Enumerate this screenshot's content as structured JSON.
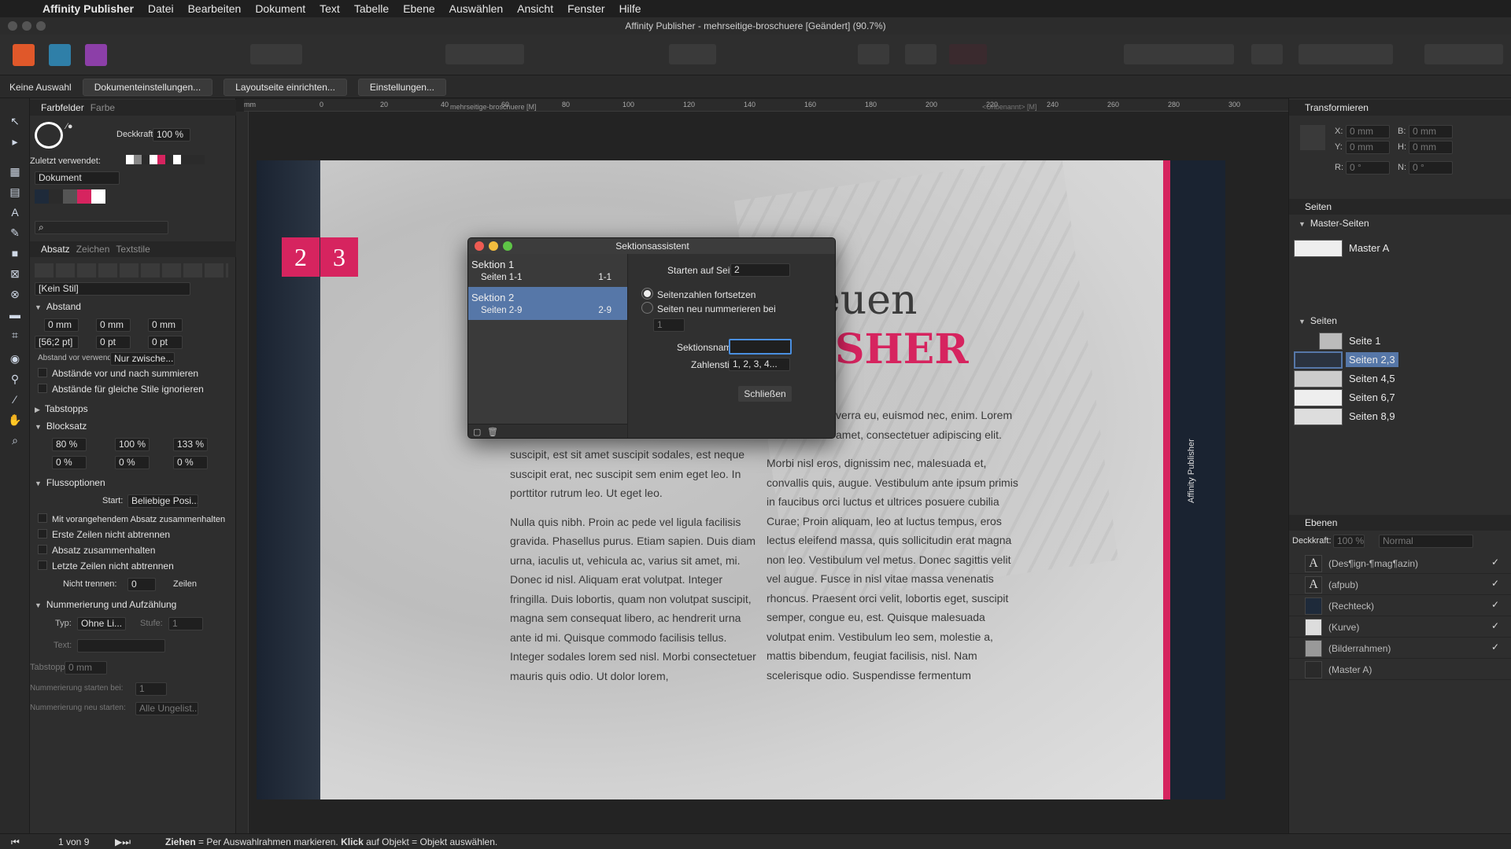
{
  "menubar": {
    "app": "Affinity Publisher",
    "items": [
      "Datei",
      "Bearbeiten",
      "Dokument",
      "Text",
      "Tabelle",
      "Ebene",
      "Auswählen",
      "Ansicht",
      "Fenster",
      "Hilfe"
    ]
  },
  "window": {
    "title": "Affinity Publisher - mehrseitige-broschuere [Geändert] (90.7%)"
  },
  "context": {
    "selection": "Keine Auswahl",
    "buttons": [
      "Dokumenteinstellungen...",
      "Layoutseite einrichten...",
      "Einstellungen..."
    ]
  },
  "doc_tabs": {
    "left": "mehrseitige-broschuere [M]",
    "right": "<Unbenannt> [M]"
  },
  "ruler_ticks": [
    "0",
    "20",
    "40",
    "60",
    "80",
    "100",
    "120",
    "140",
    "160",
    "180",
    "200",
    "220",
    "240",
    "260",
    "280",
    "300"
  ],
  "ruler_unit": "mm",
  "left_panel": {
    "tabs": [
      "Farbfelder",
      "Farbe"
    ],
    "opacity_label": "Deckkraft:",
    "opacity": "100 %",
    "recent_label": "Zuletzt verwendet:",
    "palette": "Dokument",
    "para_tabs": [
      "Absatz",
      "Zeichen",
      "Textstile"
    ],
    "style": "[Kein Stil]",
    "abstand": {
      "title": "Abstand",
      "vals": [
        "0 mm",
        "0 mm",
        "0 mm",
        "[56;2 pt]",
        "0 pt",
        "0 pt"
      ],
      "use_label": "Abstand vor verwenden:",
      "use_value": "Nur zwische...",
      "checks": [
        "Abstände vor und nach summieren",
        "Abstände für gleiche Stile ignorieren"
      ]
    },
    "tabstopps": "Tabstopps",
    "blocksatz": {
      "title": "Blocksatz",
      "vals": [
        "80 %",
        "100 %",
        "133 %",
        "0 %",
        "0 %",
        "0 %"
      ]
    },
    "fluss": {
      "title": "Flussoptionen",
      "start_label": "Start:",
      "start_value": "Beliebige Posi...",
      "checks": [
        "Mit vorangehendem Absatz zusammenhalten",
        "Erste Zeilen nicht abtrennen",
        "Absatz zusammenhalten",
        "Letzte Zeilen nicht abtrennen"
      ],
      "nicht_label": "Nicht trennen:",
      "nicht_value": "0",
      "zeilen": "Zeilen"
    },
    "nummer": {
      "title": "Nummerierung und Aufzählung",
      "typ_label": "Typ:",
      "typ_value": "Ohne Li...",
      "stufe_label": "Stufe:",
      "stufe_value": "1",
      "text_label": "Text:",
      "tab_label": "Tabstopp:",
      "tab_value": "0 mm",
      "start_label": "Nummerierung starten bei:",
      "start_value": "1",
      "restart_label": "Nummerierung neu starten:",
      "restart_value": "Alle Ungelist..."
    }
  },
  "page": {
    "numbers": [
      "2",
      "3"
    ],
    "headline1": "euen",
    "headline2": "SHER",
    "vertical_label": "Affinity Publisher",
    "col1": [
      "suscipit, est sit amet suscipit sodales, est neque suscipit erat, nec suscipit sem enim eget leo. In porttitor rutrum leo. Ut eget leo.",
      "Nulla quis nibh. Proin ac pede vel ligula facilisis gravida. Phasellus purus. Etiam sapien. Duis diam urna, iaculis ut, vehicula ac, varius sit amet, mi. Donec id nisl. Aliquam erat volutpat. Integer fringilla. Duis lobortis, quam non volutpat suscipit, magna sem consequat libero, ac hendrerit urna ante id mi. Quisque commodo facilisis tellus. Integer sodales lorem sed nisl. Morbi consectetuer mauris quis odio. Ut dolor lorem,"
    ],
    "col2": [
      "verra eu, euismod nec, enim. Lorem amet, consectetuer adipiscing elit.",
      "Morbi nisl eros, dignissim nec, malesuada et, convallis quis, augue. Vestibulum ante ipsum primis in faucibus orci luctus et ultrices posuere cubilia Curae; Proin aliquam, leo at luctus tempus, eros lectus eleifend massa, quis sollicitudin erat magna non leo. Vestibulum vel metus. Donec sagittis velit vel augue. Fusce in nisl vitae massa venenatis rhoncus. Praesent orci velit, lobortis eget, suscipit semper, congue eu, est. Quisque malesuada volutpat enim. Vestibulum leo sem, molestie a, mattis bibendum, feugiat facilisis, nisl. Nam scelerisque odio. Suspendisse fermentum"
    ]
  },
  "dialog": {
    "title": "Sektionsassistent",
    "sections": [
      {
        "name": "Sektion 1",
        "pages": "Seiten 1-1",
        "range": "1-1"
      },
      {
        "name": "Sektion 2",
        "pages": "Seiten 2-9",
        "range": "2-9"
      }
    ],
    "start_label": "Starten auf Seite:",
    "start_value": "2",
    "radio1": "Seitenzahlen fortsetzen",
    "radio2": "Seiten neu nummerieren bei",
    "renumber_value": "1",
    "name_label": "Sektionsname:",
    "name_value": "",
    "style_label": "Zahlenstil:",
    "style_value": "1, 2, 3, 4...",
    "close": "Schließen"
  },
  "right_panel": {
    "transform": {
      "title": "Transformieren",
      "x": "0 mm",
      "y": "0 mm",
      "b": "0 mm",
      "h": "0 mm",
      "r": "0 °",
      "n": "0 °",
      "labels": [
        "X:",
        "Y:",
        "B:",
        "H:",
        "R:",
        "N:"
      ]
    },
    "pages_title": "Seiten",
    "master_title": "Master-Seiten",
    "master": "Master A",
    "pages_sub": "Seiten",
    "pages": [
      "Seite 1",
      "Seiten 2,3",
      "Seiten 4,5",
      "Seiten 6,7",
      "Seiten 8,9"
    ],
    "layers_title": "Ebenen",
    "layer_opacity_label": "Deckkraft:",
    "layer_opacity": "100 %",
    "blend": "Normal",
    "layers": [
      "(Des¶ign-¶mag¶azin)",
      "(afpub)",
      "(Rechteck)",
      "(Kurve)",
      "(Bilderrahmen)",
      "(Master A)"
    ]
  },
  "status": {
    "page": "1 von 9",
    "hint_b1": "Ziehen",
    "hint1": " = Per Auswahlrahmen markieren. ",
    "hint_b2": "Klick",
    "hint2": " auf Objekt = Objekt auswählen."
  },
  "colors": {
    "accent": "#d6245f",
    "selection": "#5677a8"
  }
}
